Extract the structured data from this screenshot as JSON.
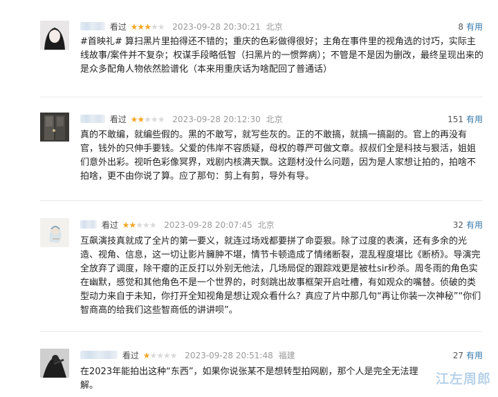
{
  "reviews": [
    {
      "watched": "看过",
      "stars": 3,
      "time": "2023-09-28 20:30:21",
      "location": "北京",
      "useful_count": "8",
      "useful_label": "有用",
      "content": "#首映礼# 算扫黑片里拍得还不错的；重庆的色彩做得很好；主角在事件里的视角选的讨巧，实际主线故事/案件并不复杂；权谋手段略低智（扫黑片的一惯弊病）；不管是不是因为删改，最终呈现出来的是众多配角人物依然脸谱化（本来用重庆话为啥配回了普通话）"
    },
    {
      "watched": "看过",
      "stars": 2,
      "time": "2023-09-28 20:12:30",
      "location": "北京",
      "useful_count": "151",
      "useful_label": "有用",
      "content": "真的不敢编，就编些假的。黑的不敢写，就写些灰的。正的不敢搞，就搞一搞副的。官上的再没有官，钱外的只伸手要钱。父爱的伟岸不容质疑，母权的尊严可做文章。叔叔们全是科技与狠活，姐姐们意外出彩。视听色彩像冥界，戏剧内核满天飘。这题材没什么问题，因为是人家想让拍的，拍啥不拍啥，更不由你说了算。应了那句：剪上有剪，导外有导。"
    },
    {
      "watched": "看过",
      "stars": 2,
      "time": "2023-09-28 20:07:45",
      "location": "北京",
      "useful_count": "32",
      "useful_label": "有用",
      "content": "互飙演技真就成了全片的第一要义，就连过场戏都要拼了命耍狠。除了过度的表演，还有多余的光造、视角、信息，这一切让影片臃肿不堪，情节卡顿造成了情绪断裂，混乱程度堪比《断桥》。导演完全放弃了调度，除干瘪的正反打以外别无他法，几场局促的跟踪戏更是被杜sir秒杀。周冬雨的角色实在幽默，感觉和其他角色不是一个世界的，时刻跳出故事框架开启吐槽，有如观众的嘴替。侦破的类型动力来自于未知，你打开全知视角是想让观众看什么？真应了片中那几句“再让你装一次神秘”“你们智商高的给我们这些智商低的讲讲呗”。"
    },
    {
      "watched": "看过",
      "stars": 1,
      "time": "2023-09-28 20:51:48",
      "location": "福建",
      "useful_count": "27",
      "useful_label": "有用",
      "content": "在2023年能拍出这种“东西”，如果你说张某不是想转型拍网剧，那个人是完全无法理解。"
    }
  ],
  "watermark": "江左周郎"
}
